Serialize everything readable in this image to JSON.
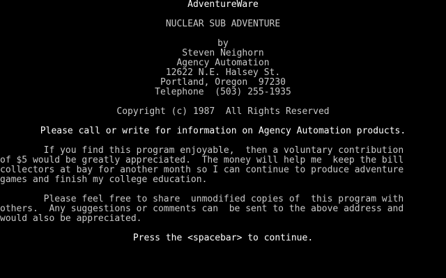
{
  "screen": {
    "brand": "AdventureWare",
    "title": "NUCLEAR SUB ADVENTURE",
    "by": "by",
    "author": "Steven Neighorn",
    "company": "Agency Automation",
    "street": "12622 N.E. Halsey St.",
    "city": "Portland, Oregon  97230",
    "phone": "Telephone  (503) 255-1935",
    "copyright": "Copyright (c) 1987  All Rights Reserved",
    "call_to_action": "Please call or write for information on Agency Automation products.",
    "para1": [
      "        If you find this program enjoyable,  then a voluntary contribution",
      "of $5 would be greatly appreciated.  The money will help me  keep the bill",
      "collectors at bay for another month so I can continue to produce adventure",
      "games and finish my college education."
    ],
    "para2": [
      "        Please feel free to share  unmodified copies of  this program with",
      "others.  Any suggestions or comments can  be sent to the above address and",
      "would also be appreciated."
    ],
    "prompt": "Press the <spacebar> to continue."
  },
  "colors": {
    "background": "#000000",
    "text": "#c8c8c8",
    "bright_text": "#ffffff"
  }
}
